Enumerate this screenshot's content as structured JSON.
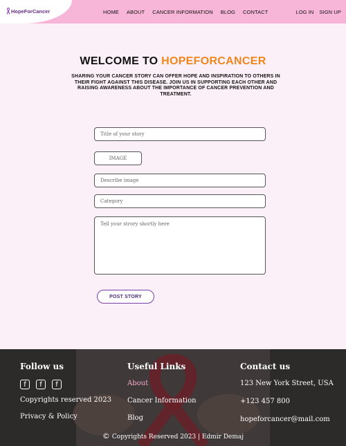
{
  "header": {
    "logo_text": "HopeForCancer",
    "logo_icon": "awareness-ribbon-icon",
    "nav": [
      "HOME",
      "ABOUT",
      "CANCER INFORMATION",
      "BLOG",
      "CONTACT"
    ],
    "auth": [
      "LOG IN",
      "SIGN UP"
    ]
  },
  "main": {
    "welcome_prefix": "WELCOME TO ",
    "welcome_brand": "HOPEFORCANCER",
    "intro": "SHARING YOUR CANCER STORY CAN OFFER HOPE AND INSPIRATION TO OTHERS IN THEIR FIGHT AGAINST THIS DISEASE. JOIN US IN SUPPORTING EACH OTHER AND RAISING AWARENESS ABOUT THE IMPORTANCE OF CANCER PREVENTION AND TREATMENT.",
    "form": {
      "title_placeholder": "Title of your story",
      "image_button": "IMAGE",
      "describe_placeholder": "Describe image",
      "category_placeholder": "Category",
      "story_placeholder": "Tell your strory shortly here",
      "post_button": "POST STORY"
    }
  },
  "footer": {
    "follow_heading": "Follow us",
    "social_icons": [
      "facebook-icon",
      "facebook-icon",
      "facebook-icon"
    ],
    "copyrights_text": "Copyrights reserved 2023",
    "privacy": "Privacy & Policy",
    "links_heading": "Useful Links",
    "links": [
      "About",
      "Cancer Information",
      "Blog"
    ],
    "contact_heading": "Contact us",
    "address": "123 New York Street, USA",
    "phone": "+123 457 800",
    "email": "hopeforcancer@mail.com",
    "bottom_copyright": "Copyrights Reserved 2023 | Edmir Demaj"
  },
  "colors": {
    "header_bg": "#f7b6d8",
    "page_bg": "#fcf0f8",
    "brand_orange": "#f0861e",
    "logo_purple": "#6a2e8c",
    "footer_link_active": "#f9a9cf"
  }
}
